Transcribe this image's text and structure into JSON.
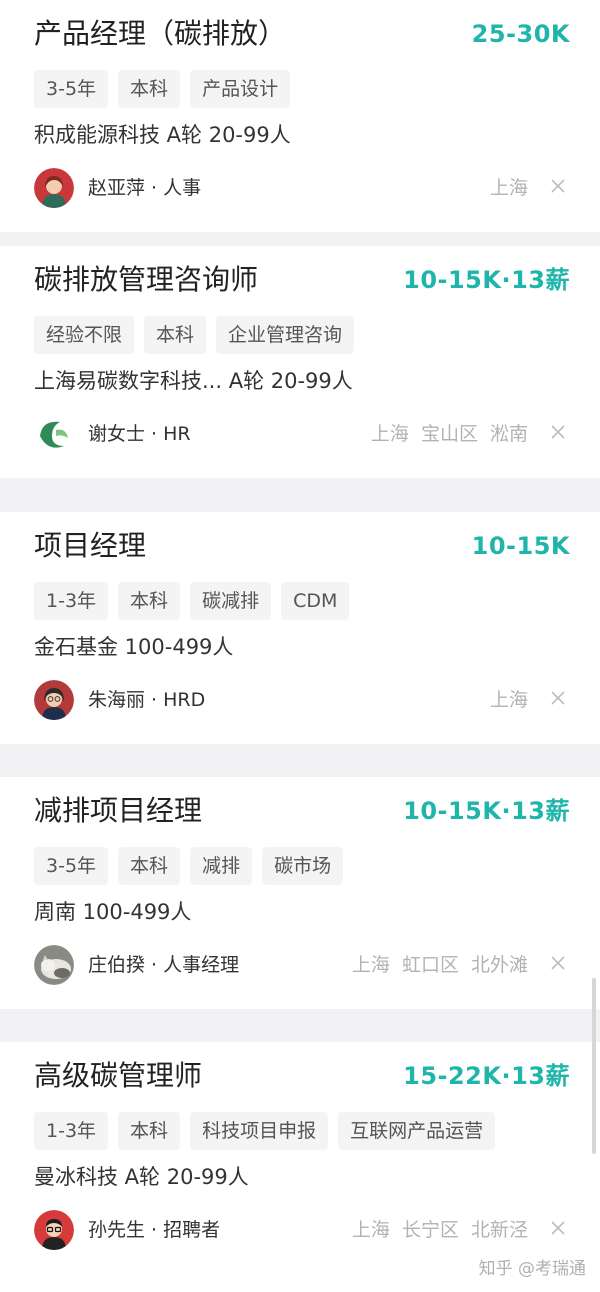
{
  "jobs": [
    {
      "title": "产品经理（碳排放）",
      "salary": "25-30K",
      "tags": [
        "3-5年",
        "本科",
        "产品设计"
      ],
      "company": "积成能源科技  A轮  20-99人",
      "recruiter": "赵亚萍 · 人事",
      "location": "上海",
      "avatar_icon": "woman-red-hair-avatar-icon"
    },
    {
      "title": "碳排放管理咨询师",
      "salary": "10-15K·13薪",
      "tags": [
        "经验不限",
        "本科",
        "企业管理咨询"
      ],
      "company": "上海易碳数字科技...  A轮  20-99人",
      "recruiter": "谢女士 · HR",
      "location": "上海  宝山区  淞南",
      "avatar_icon": "green-leaf-logo-icon"
    },
    {
      "title": "项目经理",
      "salary": "10-15K",
      "tags": [
        "1-3年",
        "本科",
        "碳减排",
        "CDM"
      ],
      "company": "金石基金  100-499人",
      "recruiter": "朱海丽 · HRD",
      "location": "上海",
      "avatar_icon": "woman-glasses-avatar-icon"
    },
    {
      "title": "减排项目经理",
      "salary": "10-15K·13薪",
      "tags": [
        "3-5年",
        "本科",
        "减排",
        "碳市场"
      ],
      "company": "周南  100-499人",
      "recruiter": "庄伯揆 · 人事经理",
      "location": "上海  虹口区  北外滩",
      "avatar_icon": "cat-photo-avatar-icon"
    },
    {
      "title": "高级碳管理师",
      "salary": "15-22K·13薪",
      "tags": [
        "1-3年",
        "本科",
        "科技项目申报",
        "互联网产品运营"
      ],
      "company": "曼冰科技  A轮  20-99人",
      "recruiter": "孙先生 · 招聘者",
      "location": "上海  长宁区  北新泾",
      "avatar_icon": "man-glasses-avatar-icon"
    }
  ],
  "watermark": "知乎 @考瑞通",
  "colors": {
    "salary": "#1fb5ab",
    "background": "#f2f2f4",
    "card": "#ffffff",
    "tag_bg": "#f4f4f5",
    "location": "#b3b3b3"
  }
}
